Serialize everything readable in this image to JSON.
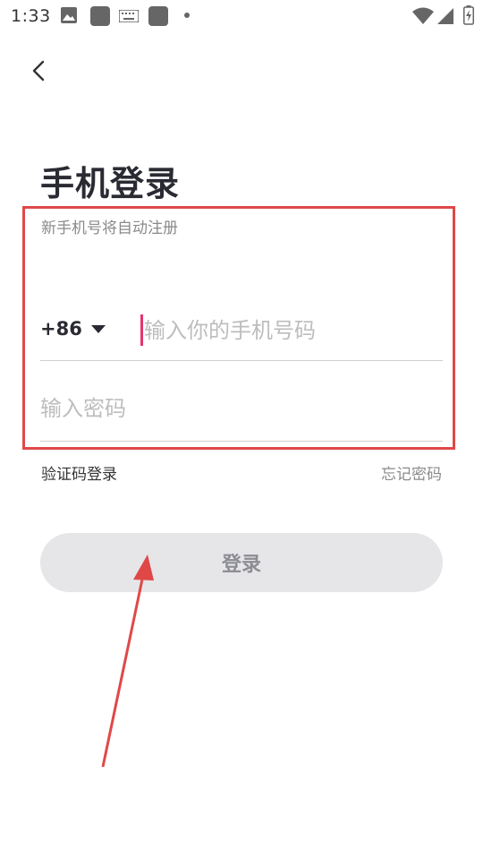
{
  "status_bar": {
    "time": "1:33",
    "icons": [
      "image-icon",
      "app-icon",
      "keyboard-icon",
      "app-icon",
      "dot-icon",
      "wifi-icon",
      "signal-icon",
      "battery-icon"
    ]
  },
  "nav": {
    "back_icon": "chevron-left-icon"
  },
  "page": {
    "title": "手机登录"
  },
  "form": {
    "hint": "新手机号将自动注册",
    "country_code": "+86",
    "phone_placeholder": "输入你的手机号码",
    "phone_value": "",
    "password_placeholder": "输入密码",
    "password_value": "",
    "cursor_color": "#e8336c"
  },
  "links": {
    "sms_login": "验证码登录",
    "forgot_password": "忘记密码"
  },
  "actions": {
    "login_label": "登录"
  },
  "annotation": {
    "color": "#e04848"
  }
}
